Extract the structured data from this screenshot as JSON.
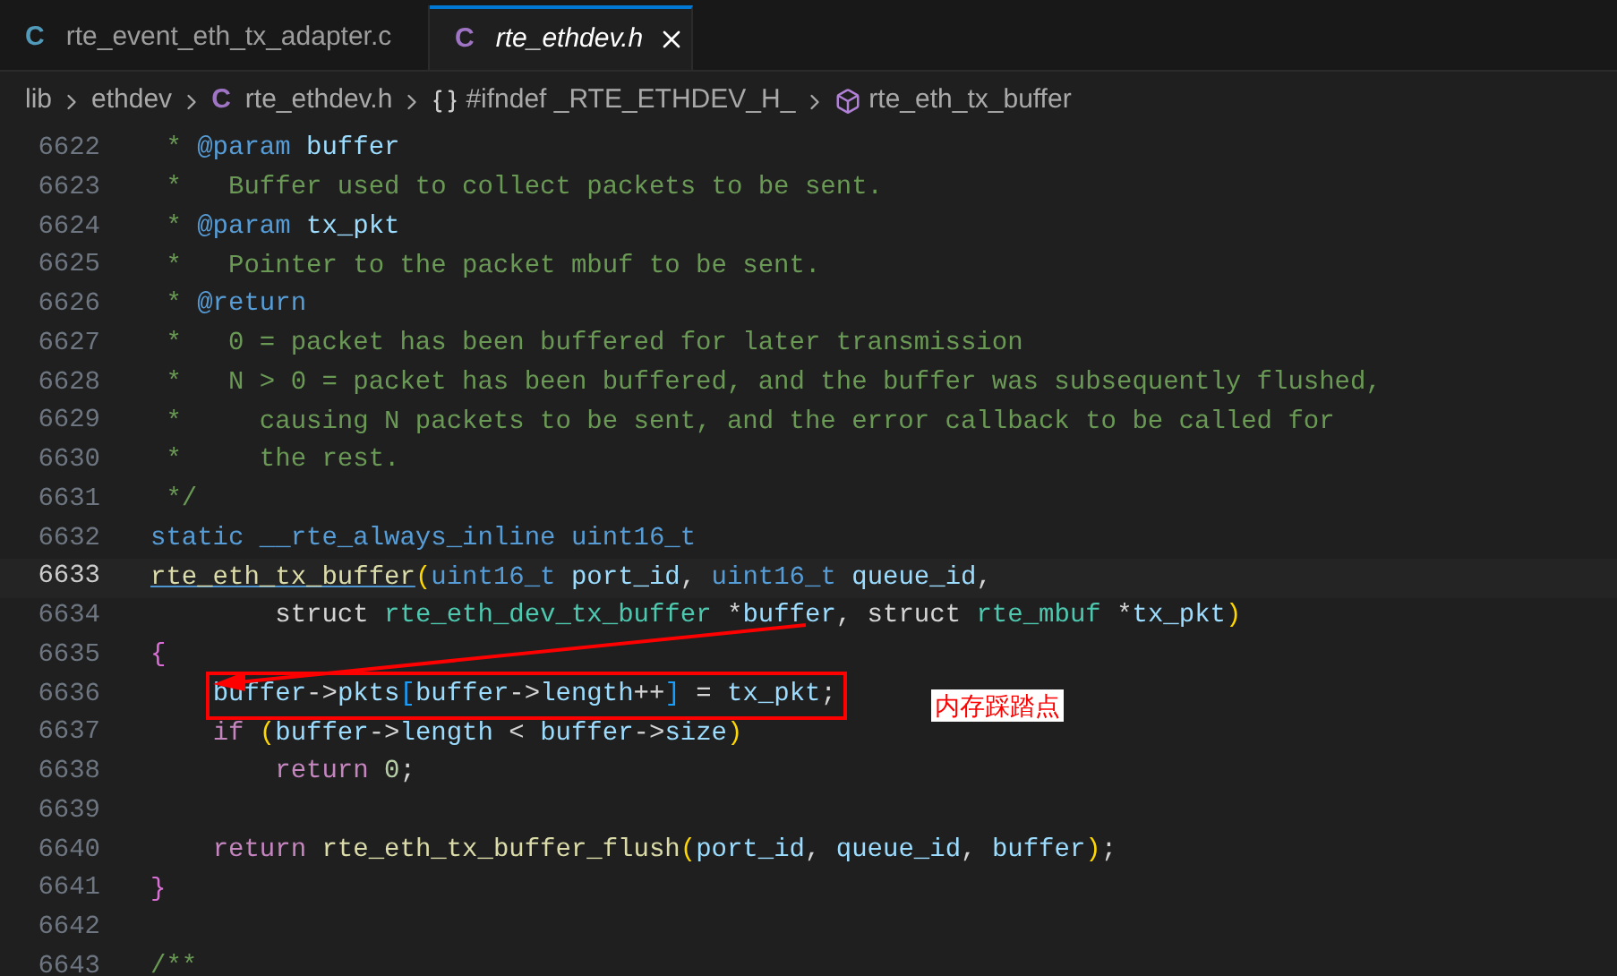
{
  "tabs": [
    {
      "icon_letter": "C",
      "color": "#519aba",
      "label": "rte_event_eth_tx_adapter.c",
      "selected": false
    },
    {
      "icon_letter": "C",
      "color": "#a074c4",
      "label": "rte_ethdev.h",
      "selected": true
    }
  ],
  "breadcrumbs": [
    {
      "kind": "folder",
      "label": "lib"
    },
    {
      "kind": "folder",
      "label": "ethdev"
    },
    {
      "kind": "file",
      "icon_letter": "C",
      "label": "rte_ethdev.h"
    },
    {
      "kind": "namespace",
      "label": "#ifndef _RTE_ETHDEV_H_"
    },
    {
      "kind": "symbol",
      "label": "rte_eth_tx_buffer"
    }
  ],
  "lines": [
    {
      "number": "6622",
      "current": false,
      "tokens": [
        {
          "kind": "comment",
          "text": " * "
        },
        {
          "kind": "doctag",
          "text": "@param"
        },
        {
          "kind": "var",
          "text": " buffer"
        }
      ]
    },
    {
      "number": "6623",
      "current": false,
      "tokens": [
        {
          "kind": "comment",
          "text": " *   Buffer used to collect packets to be sent."
        }
      ]
    },
    {
      "number": "6624",
      "current": false,
      "tokens": [
        {
          "kind": "comment",
          "text": " * "
        },
        {
          "kind": "doctag",
          "text": "@param"
        },
        {
          "kind": "var",
          "text": " tx_pkt"
        }
      ]
    },
    {
      "number": "6625",
      "current": false,
      "tokens": [
        {
          "kind": "comment",
          "text": " *   Pointer to the packet mbuf to be sent."
        }
      ]
    },
    {
      "number": "6626",
      "current": false,
      "tokens": [
        {
          "kind": "comment",
          "text": " * "
        },
        {
          "kind": "doctag",
          "text": "@return"
        }
      ]
    },
    {
      "number": "6627",
      "current": false,
      "tokens": [
        {
          "kind": "comment",
          "text": " *   0 = packet has been buffered for later transmission"
        }
      ]
    },
    {
      "number": "6628",
      "current": false,
      "tokens": [
        {
          "kind": "comment",
          "text": " *   N > 0 = packet has been buffered, and the buffer was subsequently flushed,"
        }
      ]
    },
    {
      "number": "6629",
      "current": false,
      "tokens": [
        {
          "kind": "comment",
          "text": " *     causing N packets to be sent, and the error callback to be called for"
        }
      ]
    },
    {
      "number": "6630",
      "current": false,
      "tokens": [
        {
          "kind": "comment",
          "text": " *     the rest."
        }
      ]
    },
    {
      "number": "6631",
      "current": false,
      "tokens": [
        {
          "kind": "comment",
          "text": " */"
        }
      ]
    },
    {
      "number": "6632",
      "current": false,
      "tokens": [
        {
          "kind": "keyword",
          "text": "static __rte_always_inline uint16_t"
        }
      ]
    },
    {
      "number": "6633",
      "current": true,
      "tokens": [
        {
          "kind": "link",
          "text": "rte_eth_tx_buffer"
        },
        {
          "kind": "paren",
          "text": "("
        },
        {
          "kind": "keyword",
          "text": "uint16_t "
        },
        {
          "kind": "var",
          "text": "port_id"
        },
        {
          "kind": "plain",
          "text": ", "
        },
        {
          "kind": "keyword",
          "text": "uint16_t "
        },
        {
          "kind": "var",
          "text": "queue_id"
        },
        {
          "kind": "plain",
          "text": ","
        }
      ]
    },
    {
      "number": "6634",
      "current": false,
      "tokens": [
        {
          "kind": "plain",
          "text": "        struct "
        },
        {
          "kind": "type",
          "text": "rte_eth_dev_tx_buffer "
        },
        {
          "kind": "plain",
          "text": "*"
        },
        {
          "kind": "var",
          "text": "buffer"
        },
        {
          "kind": "plain",
          "text": ", struct "
        },
        {
          "kind": "type",
          "text": "rte_mbuf "
        },
        {
          "kind": "plain",
          "text": "*"
        },
        {
          "kind": "var",
          "text": "tx_pkt"
        },
        {
          "kind": "paren",
          "text": ")"
        }
      ]
    },
    {
      "number": "6635",
      "current": false,
      "tokens": [
        {
          "kind": "brace",
          "text": "{"
        }
      ]
    },
    {
      "number": "6636",
      "current": false,
      "highlighted": true,
      "tokens": [
        {
          "kind": "var",
          "text": "    buffer"
        },
        {
          "kind": "plain",
          "text": "->"
        },
        {
          "kind": "var",
          "text": "pkts"
        },
        {
          "kind": "bracket",
          "text": "["
        },
        {
          "kind": "var",
          "text": "buffer"
        },
        {
          "kind": "plain",
          "text": "->"
        },
        {
          "kind": "var",
          "text": "length"
        },
        {
          "kind": "plain",
          "text": "++"
        },
        {
          "kind": "bracket",
          "text": "]"
        },
        {
          "kind": "plain",
          "text": " = "
        },
        {
          "kind": "var",
          "text": "tx_pkt"
        },
        {
          "kind": "plain",
          "text": ";"
        }
      ]
    },
    {
      "number": "6637",
      "current": false,
      "tokens": [
        {
          "kind": "control",
          "text": "    if "
        },
        {
          "kind": "paren",
          "text": "("
        },
        {
          "kind": "var",
          "text": "buffer"
        },
        {
          "kind": "plain",
          "text": "->"
        },
        {
          "kind": "var",
          "text": "length"
        },
        {
          "kind": "plain",
          "text": " < "
        },
        {
          "kind": "var",
          "text": "buffer"
        },
        {
          "kind": "plain",
          "text": "->"
        },
        {
          "kind": "var",
          "text": "size"
        },
        {
          "kind": "paren",
          "text": ")"
        }
      ]
    },
    {
      "number": "6638",
      "current": false,
      "tokens": [
        {
          "kind": "control",
          "text": "        return "
        },
        {
          "kind": "number",
          "text": "0"
        },
        {
          "kind": "plain",
          "text": ";"
        }
      ]
    },
    {
      "number": "6639",
      "current": false
    },
    {
      "number": "6640",
      "current": false,
      "tokens": [
        {
          "kind": "control",
          "text": "    return "
        },
        {
          "kind": "func",
          "text": "rte_eth_tx_buffer_flush"
        },
        {
          "kind": "paren",
          "text": "("
        },
        {
          "kind": "var",
          "text": "port_id"
        },
        {
          "kind": "plain",
          "text": ", "
        },
        {
          "kind": "var",
          "text": "queue_id"
        },
        {
          "kind": "plain",
          "text": ", "
        },
        {
          "kind": "var",
          "text": "buffer"
        },
        {
          "kind": "paren",
          "text": ")"
        },
        {
          "kind": "plain",
          "text": ";"
        }
      ]
    },
    {
      "number": "6641",
      "current": false,
      "tokens": [
        {
          "kind": "brace",
          "text": "}"
        }
      ]
    },
    {
      "number": "6642",
      "current": false
    },
    {
      "number": "6643",
      "current": false,
      "tokens": [
        {
          "kind": "comment",
          "text": "/**"
        }
      ]
    }
  ],
  "annotation": {
    "label": "内存踩踏点"
  }
}
